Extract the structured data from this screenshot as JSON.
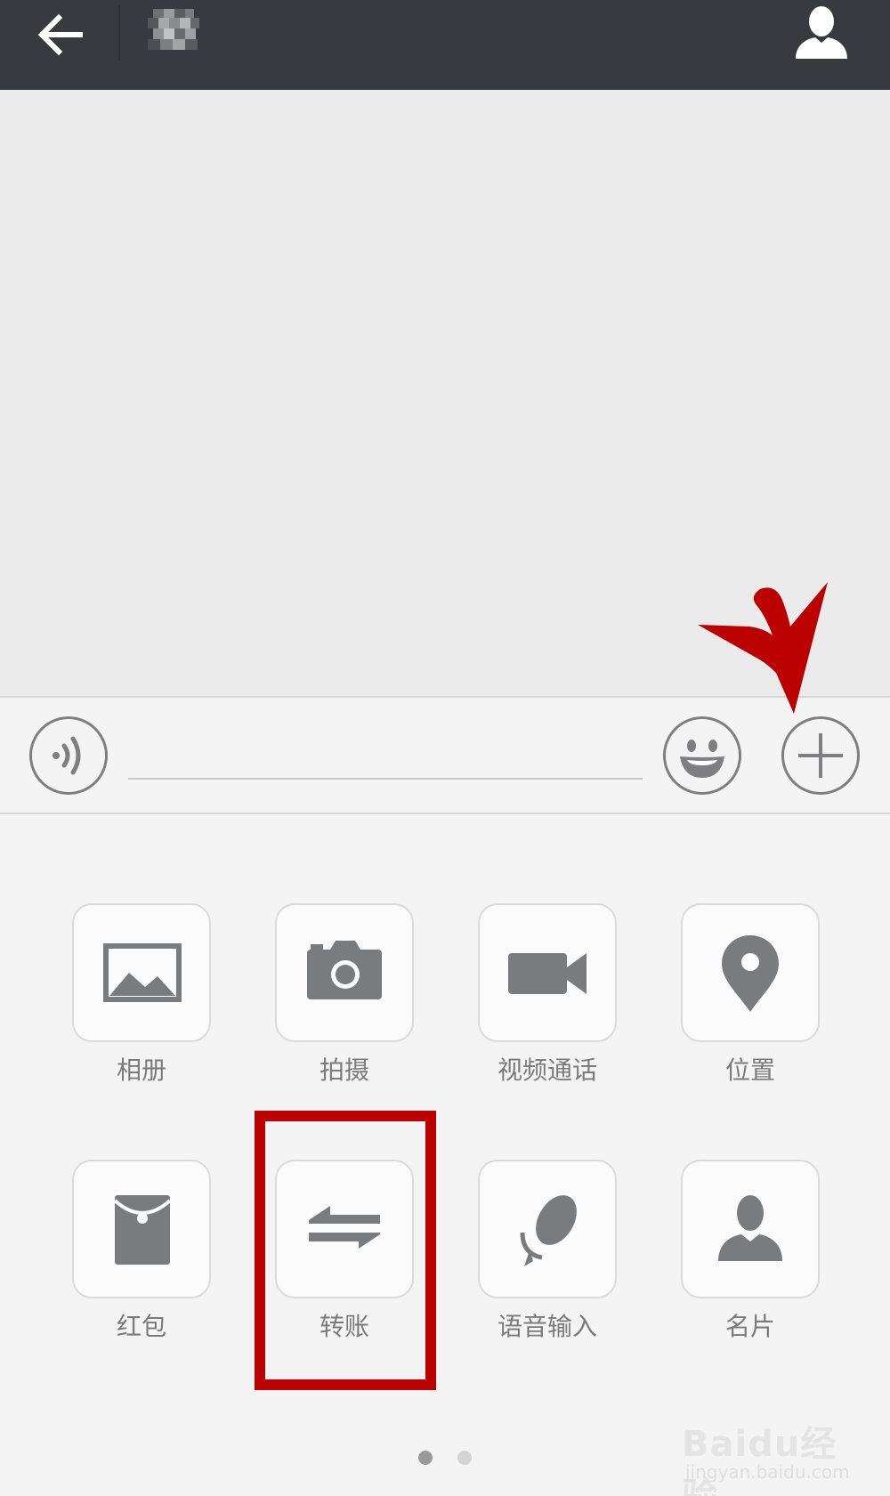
{
  "topbar": {
    "back_icon": "arrow-left-icon",
    "profile_icon": "person-icon",
    "background": "#393a3f"
  },
  "input_bar": {
    "voice_icon": "voice-icon",
    "emoji_icon": "smiley-icon",
    "plus_icon": "plus-icon",
    "text_value": ""
  },
  "panel": {
    "items": [
      {
        "label": "相册",
        "icon": "image-icon"
      },
      {
        "label": "拍摄",
        "icon": "camera-icon"
      },
      {
        "label": "视频通话",
        "icon": "video-camera-icon"
      },
      {
        "label": "位置",
        "icon": "location-pin-icon"
      },
      {
        "label": "红包",
        "icon": "red-packet-icon"
      },
      {
        "label": "转账",
        "icon": "transfer-icon"
      },
      {
        "label": "语音输入",
        "icon": "microphone-icon"
      },
      {
        "label": "名片",
        "icon": "contact-card-icon"
      }
    ],
    "page_count": 2,
    "current_page": 1
  },
  "annotations": {
    "highlight_color": "#bb0000",
    "highlighted_item": "转账",
    "arrow_target": "plus-icon"
  },
  "watermark": {
    "main": "Baidu经验",
    "sub": "jingyan.baidu.com"
  }
}
